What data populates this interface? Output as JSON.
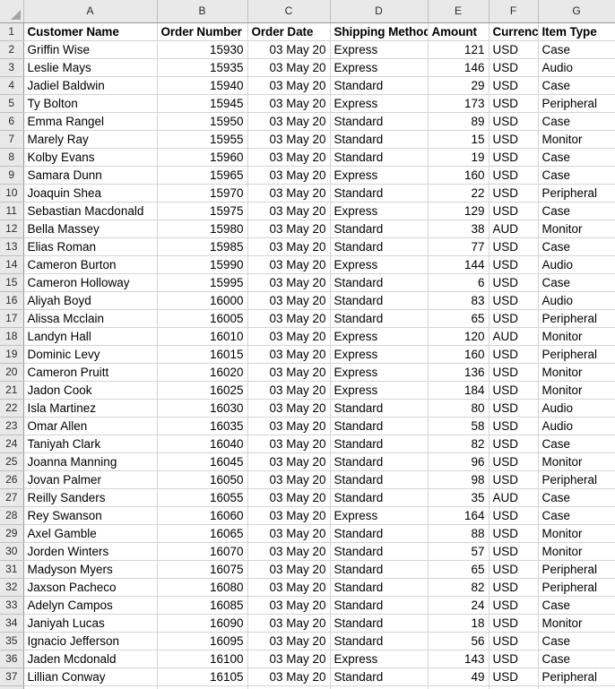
{
  "spreadsheet": {
    "select_all_label": "",
    "column_letters": [
      "A",
      "B",
      "C",
      "D",
      "E",
      "F",
      "G"
    ],
    "columns": [
      {
        "key": "customer_name",
        "letter": "A",
        "header": "Customer Name",
        "align": "left"
      },
      {
        "key": "order_number",
        "letter": "B",
        "header": "Order Number",
        "align": "right"
      },
      {
        "key": "order_date",
        "letter": "C",
        "header": "Order Date",
        "align": "right"
      },
      {
        "key": "shipping_method",
        "letter": "D",
        "header": "Shipping Method",
        "align": "left"
      },
      {
        "key": "amount",
        "letter": "E",
        "header": "Amount",
        "align": "right"
      },
      {
        "key": "currency",
        "letter": "F",
        "header": "Currency",
        "align": "left"
      },
      {
        "key": "item_type",
        "letter": "G",
        "header": "Item Type",
        "align": "left"
      }
    ],
    "header_row_number": "1",
    "row_numbers": [
      "1",
      "2",
      "3",
      "4",
      "5",
      "6",
      "7",
      "8",
      "9",
      "10",
      "11",
      "12",
      "13",
      "14",
      "15",
      "16",
      "17",
      "18",
      "19",
      "20",
      "21",
      "22",
      "23",
      "24",
      "25",
      "26",
      "27",
      "28",
      "29",
      "30",
      "31",
      "32",
      "33",
      "34",
      "35",
      "36",
      "37"
    ],
    "rows": [
      {
        "n": "2",
        "customer_name": "Griffin Wise",
        "order_number": "15930",
        "order_date": "03 May 20",
        "shipping_method": "Express",
        "amount": "121",
        "currency": "USD",
        "item_type": "Case"
      },
      {
        "n": "3",
        "customer_name": "Leslie Mays",
        "order_number": "15935",
        "order_date": "03 May 20",
        "shipping_method": "Express",
        "amount": "146",
        "currency": "USD",
        "item_type": "Audio"
      },
      {
        "n": "4",
        "customer_name": "Jadiel Baldwin",
        "order_number": "15940",
        "order_date": "03 May 20",
        "shipping_method": "Standard",
        "amount": "29",
        "currency": "USD",
        "item_type": "Case"
      },
      {
        "n": "5",
        "customer_name": "Ty Bolton",
        "order_number": "15945",
        "order_date": "03 May 20",
        "shipping_method": "Express",
        "amount": "173",
        "currency": "USD",
        "item_type": "Peripheral"
      },
      {
        "n": "6",
        "customer_name": "Emma Rangel",
        "order_number": "15950",
        "order_date": "03 May 20",
        "shipping_method": "Standard",
        "amount": "89",
        "currency": "USD",
        "item_type": "Case"
      },
      {
        "n": "7",
        "customer_name": "Marely Ray",
        "order_number": "15955",
        "order_date": "03 May 20",
        "shipping_method": "Standard",
        "amount": "15",
        "currency": "USD",
        "item_type": "Monitor"
      },
      {
        "n": "8",
        "customer_name": "Kolby Evans",
        "order_number": "15960",
        "order_date": "03 May 20",
        "shipping_method": "Standard",
        "amount": "19",
        "currency": "USD",
        "item_type": "Case"
      },
      {
        "n": "9",
        "customer_name": "Samara Dunn",
        "order_number": "15965",
        "order_date": "03 May 20",
        "shipping_method": "Express",
        "amount": "160",
        "currency": "USD",
        "item_type": "Case"
      },
      {
        "n": "10",
        "customer_name": "Joaquin Shea",
        "order_number": "15970",
        "order_date": "03 May 20",
        "shipping_method": "Standard",
        "amount": "22",
        "currency": "USD",
        "item_type": "Peripheral"
      },
      {
        "n": "11",
        "customer_name": "Sebastian Macdonald",
        "order_number": "15975",
        "order_date": "03 May 20",
        "shipping_method": "Express",
        "amount": "129",
        "currency": "USD",
        "item_type": "Case"
      },
      {
        "n": "12",
        "customer_name": "Bella Massey",
        "order_number": "15980",
        "order_date": "03 May 20",
        "shipping_method": "Standard",
        "amount": "38",
        "currency": "AUD",
        "item_type": "Monitor"
      },
      {
        "n": "13",
        "customer_name": "Elias Roman",
        "order_number": "15985",
        "order_date": "03 May 20",
        "shipping_method": "Standard",
        "amount": "77",
        "currency": "USD",
        "item_type": "Case"
      },
      {
        "n": "14",
        "customer_name": "Cameron Burton",
        "order_number": "15990",
        "order_date": "03 May 20",
        "shipping_method": "Express",
        "amount": "144",
        "currency": "USD",
        "item_type": "Audio"
      },
      {
        "n": "15",
        "customer_name": "Cameron Holloway",
        "order_number": "15995",
        "order_date": "03 May 20",
        "shipping_method": "Standard",
        "amount": "6",
        "currency": "USD",
        "item_type": "Case"
      },
      {
        "n": "16",
        "customer_name": "Aliyah Boyd",
        "order_number": "16000",
        "order_date": "03 May 20",
        "shipping_method": "Standard",
        "amount": "83",
        "currency": "USD",
        "item_type": "Audio"
      },
      {
        "n": "17",
        "customer_name": "Alissa Mcclain",
        "order_number": "16005",
        "order_date": "03 May 20",
        "shipping_method": "Standard",
        "amount": "65",
        "currency": "USD",
        "item_type": "Peripheral"
      },
      {
        "n": "18",
        "customer_name": "Landyn Hall",
        "order_number": "16010",
        "order_date": "03 May 20",
        "shipping_method": "Express",
        "amount": "120",
        "currency": "AUD",
        "item_type": "Monitor"
      },
      {
        "n": "19",
        "customer_name": "Dominic Levy",
        "order_number": "16015",
        "order_date": "03 May 20",
        "shipping_method": "Express",
        "amount": "160",
        "currency": "USD",
        "item_type": "Peripheral"
      },
      {
        "n": "20",
        "customer_name": "Cameron Pruitt",
        "order_number": "16020",
        "order_date": "03 May 20",
        "shipping_method": "Express",
        "amount": "136",
        "currency": "USD",
        "item_type": "Monitor"
      },
      {
        "n": "21",
        "customer_name": "Jadon Cook",
        "order_number": "16025",
        "order_date": "03 May 20",
        "shipping_method": "Express",
        "amount": "184",
        "currency": "USD",
        "item_type": "Monitor"
      },
      {
        "n": "22",
        "customer_name": "Isla Martinez",
        "order_number": "16030",
        "order_date": "03 May 20",
        "shipping_method": "Standard",
        "amount": "80",
        "currency": "USD",
        "item_type": "Audio"
      },
      {
        "n": "23",
        "customer_name": "Omar Allen",
        "order_number": "16035",
        "order_date": "03 May 20",
        "shipping_method": "Standard",
        "amount": "58",
        "currency": "USD",
        "item_type": "Audio"
      },
      {
        "n": "24",
        "customer_name": "Taniyah Clark",
        "order_number": "16040",
        "order_date": "03 May 20",
        "shipping_method": "Standard",
        "amount": "82",
        "currency": "USD",
        "item_type": "Case"
      },
      {
        "n": "25",
        "customer_name": "Joanna Manning",
        "order_number": "16045",
        "order_date": "03 May 20",
        "shipping_method": "Standard",
        "amount": "96",
        "currency": "USD",
        "item_type": "Monitor"
      },
      {
        "n": "26",
        "customer_name": "Jovan Palmer",
        "order_number": "16050",
        "order_date": "03 May 20",
        "shipping_method": "Standard",
        "amount": "98",
        "currency": "USD",
        "item_type": "Peripheral"
      },
      {
        "n": "27",
        "customer_name": "Reilly Sanders",
        "order_number": "16055",
        "order_date": "03 May 20",
        "shipping_method": "Standard",
        "amount": "35",
        "currency": "AUD",
        "item_type": "Case"
      },
      {
        "n": "28",
        "customer_name": "Rey Swanson",
        "order_number": "16060",
        "order_date": "03 May 20",
        "shipping_method": "Express",
        "amount": "164",
        "currency": "USD",
        "item_type": "Case"
      },
      {
        "n": "29",
        "customer_name": "Axel Gamble",
        "order_number": "16065",
        "order_date": "03 May 20",
        "shipping_method": "Standard",
        "amount": "88",
        "currency": "USD",
        "item_type": "Monitor"
      },
      {
        "n": "30",
        "customer_name": "Jorden Winters",
        "order_number": "16070",
        "order_date": "03 May 20",
        "shipping_method": "Standard",
        "amount": "57",
        "currency": "USD",
        "item_type": "Monitor"
      },
      {
        "n": "31",
        "customer_name": "Madyson Myers",
        "order_number": "16075",
        "order_date": "03 May 20",
        "shipping_method": "Standard",
        "amount": "65",
        "currency": "USD",
        "item_type": "Peripheral"
      },
      {
        "n": "32",
        "customer_name": "Jaxson Pacheco",
        "order_number": "16080",
        "order_date": "03 May 20",
        "shipping_method": "Standard",
        "amount": "82",
        "currency": "USD",
        "item_type": "Peripheral"
      },
      {
        "n": "33",
        "customer_name": "Adelyn Campos",
        "order_number": "16085",
        "order_date": "03 May 20",
        "shipping_method": "Standard",
        "amount": "24",
        "currency": "USD",
        "item_type": "Case"
      },
      {
        "n": "34",
        "customer_name": "Janiyah Lucas",
        "order_number": "16090",
        "order_date": "03 May 20",
        "shipping_method": "Standard",
        "amount": "18",
        "currency": "USD",
        "item_type": "Monitor"
      },
      {
        "n": "35",
        "customer_name": "Ignacio Jefferson",
        "order_number": "16095",
        "order_date": "03 May 20",
        "shipping_method": "Standard",
        "amount": "56",
        "currency": "USD",
        "item_type": "Case"
      },
      {
        "n": "36",
        "customer_name": "Jaden Mcdonald",
        "order_number": "16100",
        "order_date": "03 May 20",
        "shipping_method": "Express",
        "amount": "143",
        "currency": "USD",
        "item_type": "Case"
      },
      {
        "n": "37",
        "customer_name": "Lillian Conway",
        "order_number": "16105",
        "order_date": "03 May 20",
        "shipping_method": "Standard",
        "amount": "49",
        "currency": "USD",
        "item_type": "Peripheral"
      }
    ],
    "colors": {
      "header_band": "#e9e9e9",
      "gridline": "#d4d4d4",
      "header_border": "#9a9a9a",
      "text": "#000000"
    }
  }
}
